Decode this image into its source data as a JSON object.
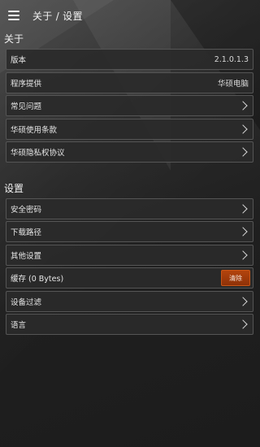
{
  "header": {
    "title": "关于 / 设置"
  },
  "about": {
    "section_label": "关于",
    "version": {
      "label": "版本",
      "value": "2.1.0.1.3"
    },
    "provider": {
      "label": "程序提供",
      "value": "华硕电脑"
    },
    "faq": {
      "label": "常见问题"
    },
    "terms": {
      "label": "华硕使用条款"
    },
    "privacy": {
      "label": "华硕隐私权协议"
    }
  },
  "settings": {
    "section_label": "设置",
    "security_pin": {
      "label": "安全密码"
    },
    "download_path": {
      "label": "下载路径"
    },
    "other_settings": {
      "label": "其他设置"
    },
    "cache": {
      "label": "缓存 (0 Bytes)",
      "clear_label": "清除"
    },
    "device_filter": {
      "label": "设备过滤"
    },
    "language": {
      "label": "语言"
    }
  },
  "colors": {
    "accent": "#9a3a0a",
    "row_bg": "#2a2a2a",
    "border": "#555555"
  }
}
